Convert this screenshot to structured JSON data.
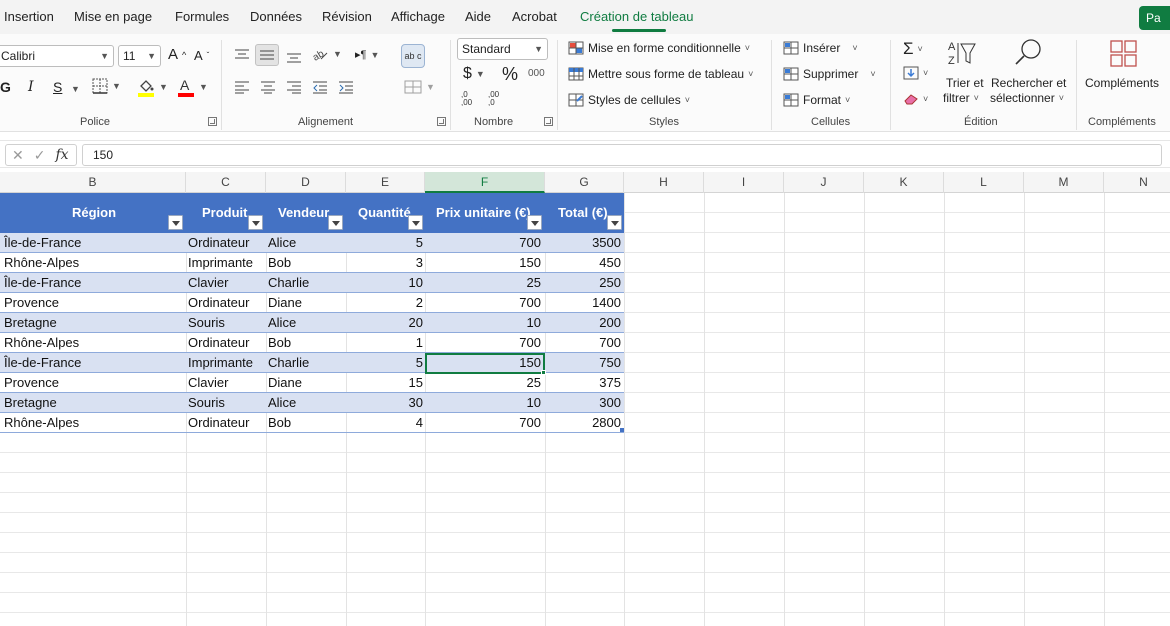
{
  "menu": {
    "tabs": [
      "Insertion",
      "Mise en page",
      "Formules",
      "Données",
      "Révision",
      "Affichage",
      "Aide",
      "Acrobat",
      "Création de tableau"
    ],
    "active_tab": "Création de tableau",
    "share_label": "Pa"
  },
  "ribbon": {
    "police": {
      "label": "Police",
      "font_name": "Calibri",
      "font_size": "11",
      "grow": "A",
      "shrink": "A",
      "bold": "G",
      "italic": "I",
      "underline": "S",
      "highlight_color": "#ffff00",
      "font_color": "#ff0000"
    },
    "alignement": {
      "label": "Alignement",
      "wrap": "ab c"
    },
    "nombre": {
      "label": "Nombre",
      "format": "Standard",
      "currency": "$",
      "percent": "%",
      "thousands": "000",
      "inc_decimal": ",0 ,00",
      "dec_decimal": ",00 ,0"
    },
    "styles": {
      "label": "Styles",
      "conditional": "Mise en forme conditionnelle",
      "as_table": "Mettre sous forme de tableau",
      "cell_styles": "Styles de cellules"
    },
    "cellules": {
      "label": "Cellules",
      "insert": "Insérer",
      "delete": "Supprimer",
      "format": "Format"
    },
    "edition": {
      "label": "Édition",
      "sort_line1": "Trier et",
      "sort_line2": "filtrer",
      "find_line1": "Rechercher et",
      "find_line2": "sélectionner"
    },
    "complements": {
      "label": "Compléments",
      "button": "Compléments"
    }
  },
  "formula_bar": {
    "value": "150",
    "fx": "fx"
  },
  "columns": [
    "B",
    "C",
    "D",
    "E",
    "F",
    "G",
    "H",
    "I",
    "J",
    "K",
    "L",
    "M",
    "N"
  ],
  "selected_column": "F",
  "table": {
    "header_color": "#4472c4",
    "band_color": "#d9e1f2",
    "headers": [
      "Région",
      "Produit",
      "Vendeur",
      "Quantité",
      "Prix unitaire (€)",
      "Total (€)"
    ],
    "rows": [
      [
        "Île-de-France",
        "Ordinateur",
        "Alice",
        "5",
        "700",
        "3500"
      ],
      [
        "Rhône-Alpes",
        "Imprimante",
        "Bob",
        "3",
        "150",
        "450"
      ],
      [
        "Île-de-France",
        "Clavier",
        "Charlie",
        "10",
        "25",
        "250"
      ],
      [
        "Provence",
        "Ordinateur",
        "Diane",
        "2",
        "700",
        "1400"
      ],
      [
        "Bretagne",
        "Souris",
        "Alice",
        "20",
        "10",
        "200"
      ],
      [
        "Rhône-Alpes",
        "Ordinateur",
        "Bob",
        "1",
        "700",
        "700"
      ],
      [
        "Île-de-France",
        "Imprimante",
        "Charlie",
        "5",
        "150",
        "750"
      ],
      [
        "Provence",
        "Clavier",
        "Diane",
        "15",
        "25",
        "375"
      ],
      [
        "Bretagne",
        "Souris",
        "Alice",
        "30",
        "10",
        "300"
      ],
      [
        "Rhône-Alpes",
        "Ordinateur",
        "Bob",
        "4",
        "700",
        "2800"
      ]
    ]
  },
  "accent_color": "#107c41"
}
